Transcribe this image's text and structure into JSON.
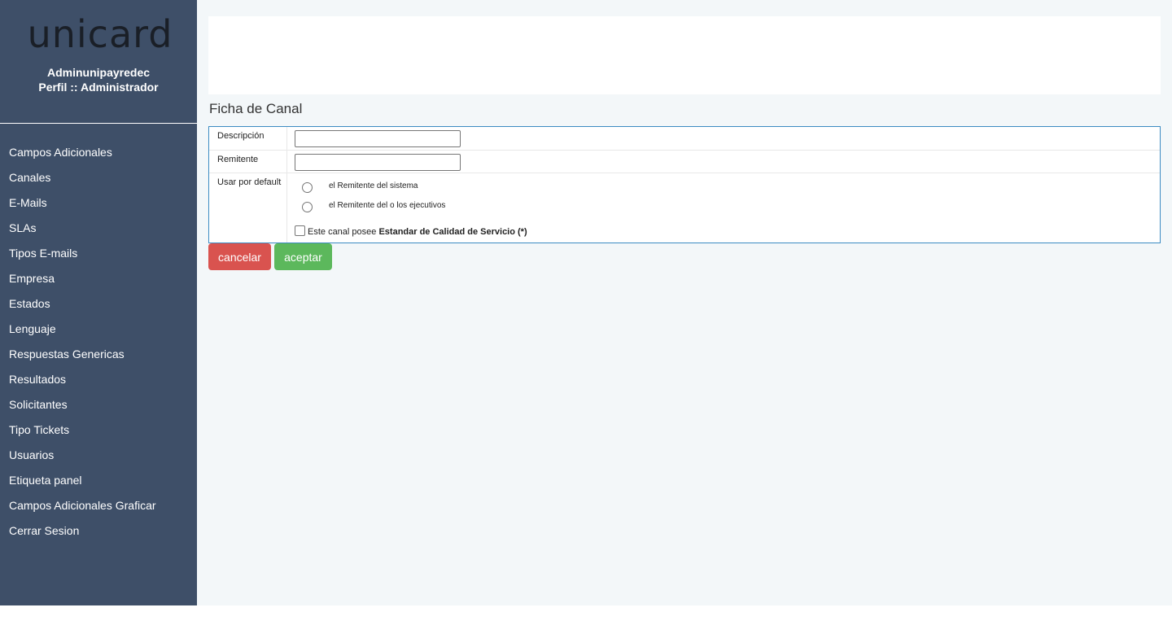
{
  "brand": {
    "logo_text": "unicard"
  },
  "user": {
    "name": "Adminunipayredec",
    "profile": "Perfil :: Administrador"
  },
  "sidebar": {
    "items": [
      {
        "label": "Campos Adicionales"
      },
      {
        "label": "Canales"
      },
      {
        "label": "E-Mails"
      },
      {
        "label": "SLAs"
      },
      {
        "label": "Tipos E-mails"
      },
      {
        "label": "Empresa"
      },
      {
        "label": "Estados"
      },
      {
        "label": "Lenguaje"
      },
      {
        "label": "Respuestas Genericas"
      },
      {
        "label": "Resultados"
      },
      {
        "label": "Solicitantes"
      },
      {
        "label": "Tipo Tickets"
      },
      {
        "label": "Usuarios"
      },
      {
        "label": "Etiqueta panel"
      },
      {
        "label": "Campos Adicionales Graficar"
      },
      {
        "label": "Cerrar Sesion"
      }
    ]
  },
  "page": {
    "title": "Ficha de Canal"
  },
  "form": {
    "descripcion": {
      "label": "Descripción",
      "value": ""
    },
    "remitente": {
      "label": "Remitente",
      "value": ""
    },
    "usar_por_default": {
      "label": "Usar por default",
      "options": [
        {
          "label": "el Remitente del sistema",
          "checked": false
        },
        {
          "label": "el Remitente del o los ejecutivos",
          "checked": false
        }
      ]
    },
    "sla_checkbox": {
      "prefix": "Este canal posee ",
      "bold": "Estandar de Calidad de Servicio (*)",
      "checked": false
    }
  },
  "actions": {
    "cancel_label": "cancelar",
    "accept_label": "aceptar"
  },
  "colors": {
    "sidebar_bg": "#3e4f68",
    "page_bg": "#f3f7f9",
    "form_border": "#3b8bc2",
    "cancel_bg": "#d9534f",
    "accept_bg": "#5cb85c"
  }
}
